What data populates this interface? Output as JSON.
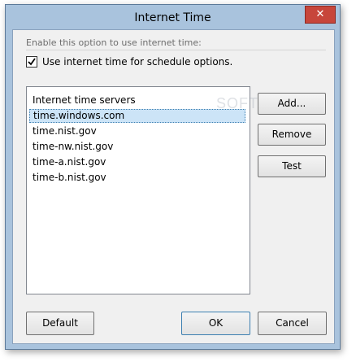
{
  "window": {
    "title": "Internet Time",
    "close_glyph": "✕"
  },
  "options": {
    "hint": "Enable this option to use internet time:",
    "checkbox_label": "Use internet time for schedule options.",
    "checkbox_checked": true
  },
  "servers": {
    "header": "Internet time servers",
    "items": [
      "time.windows.com",
      "time.nist.gov",
      "time-nw.nist.gov",
      "time-a.nist.gov",
      "time-b.nist.gov"
    ],
    "selected_index": 0
  },
  "buttons": {
    "add": "Add...",
    "remove": "Remove",
    "test": "Test",
    "default": "Default",
    "ok": "OK",
    "cancel": "Cancel"
  },
  "watermark": "SOFTPEDIA",
  "colors": {
    "frame": "#a9c3dd",
    "close": "#c7463b",
    "selection": "#cce4f7"
  }
}
